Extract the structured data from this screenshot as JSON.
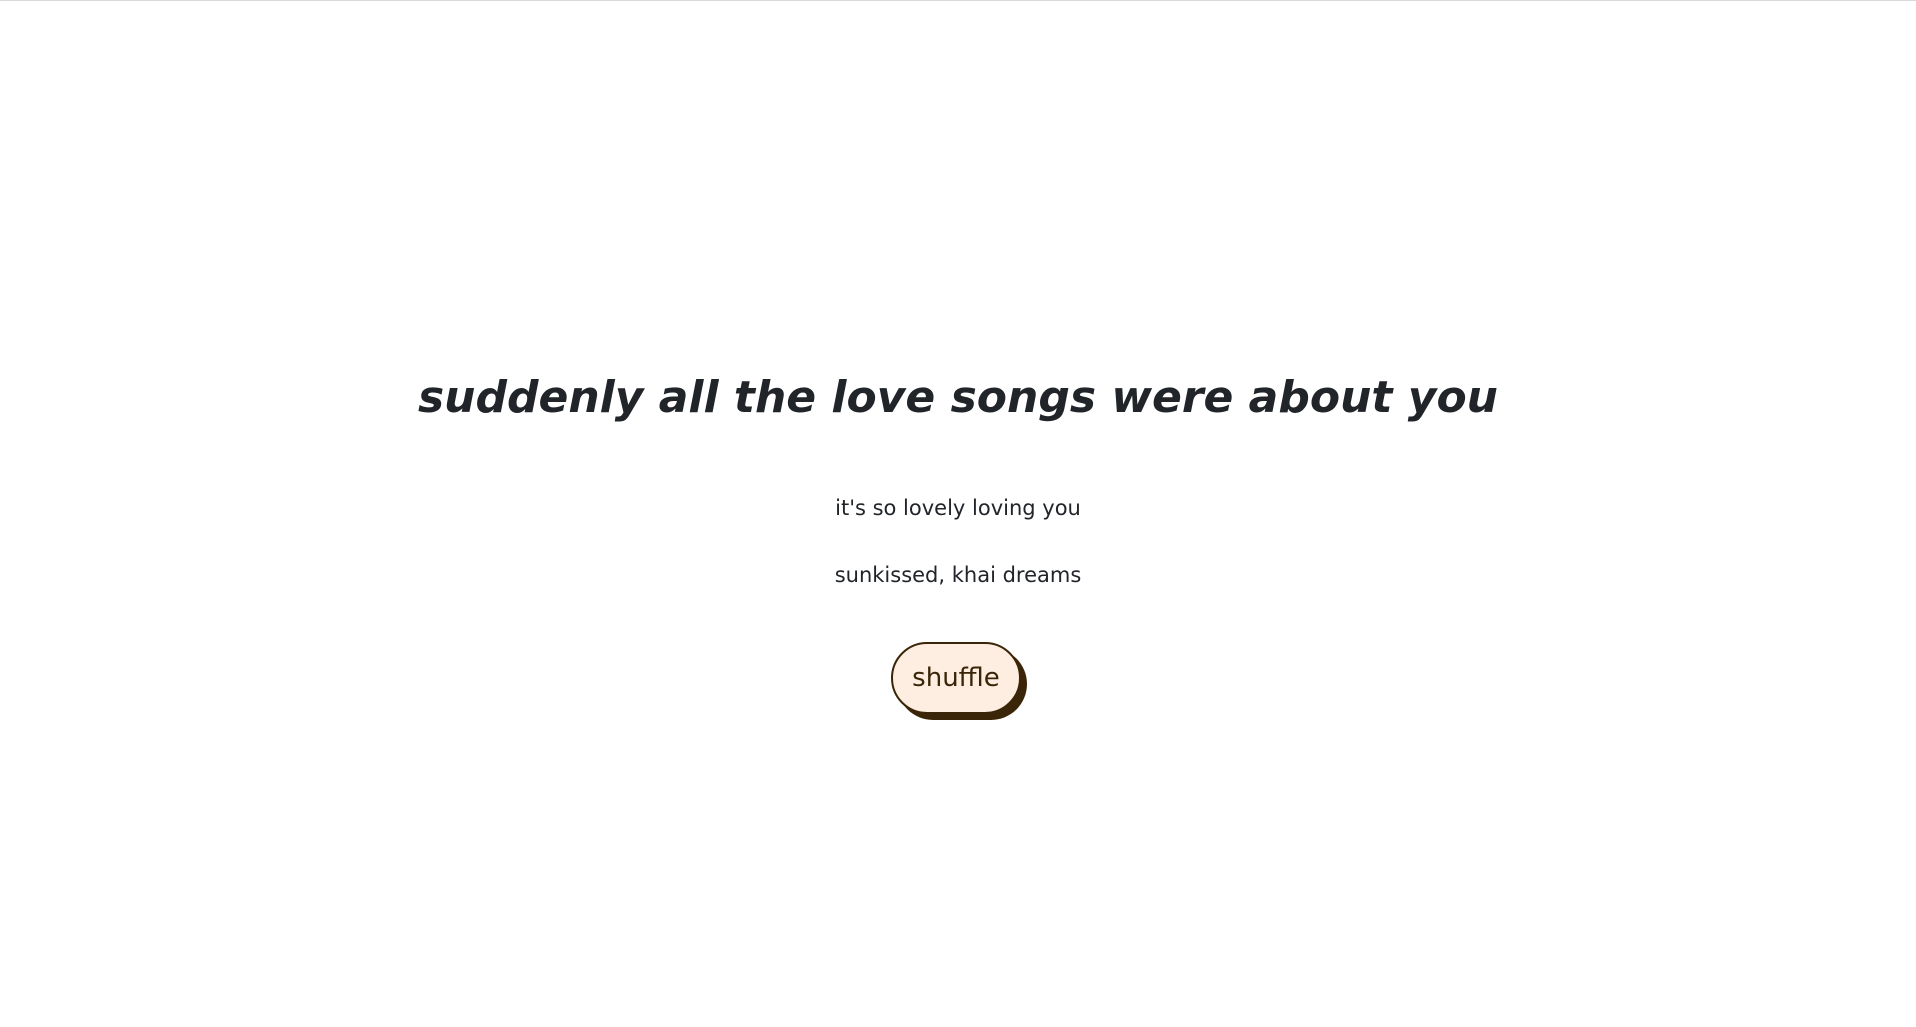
{
  "quote": {
    "text": "suddenly all the love songs were about you"
  },
  "song": {
    "title": "it's so lovely loving you",
    "artist_line": "sunkissed, khai dreams"
  },
  "controls": {
    "shuffle_label": "shuffle"
  },
  "colors": {
    "background": "#ffffff",
    "text": "#212529",
    "button_fill": "#fdeee1",
    "button_ink": "#3b2508"
  }
}
